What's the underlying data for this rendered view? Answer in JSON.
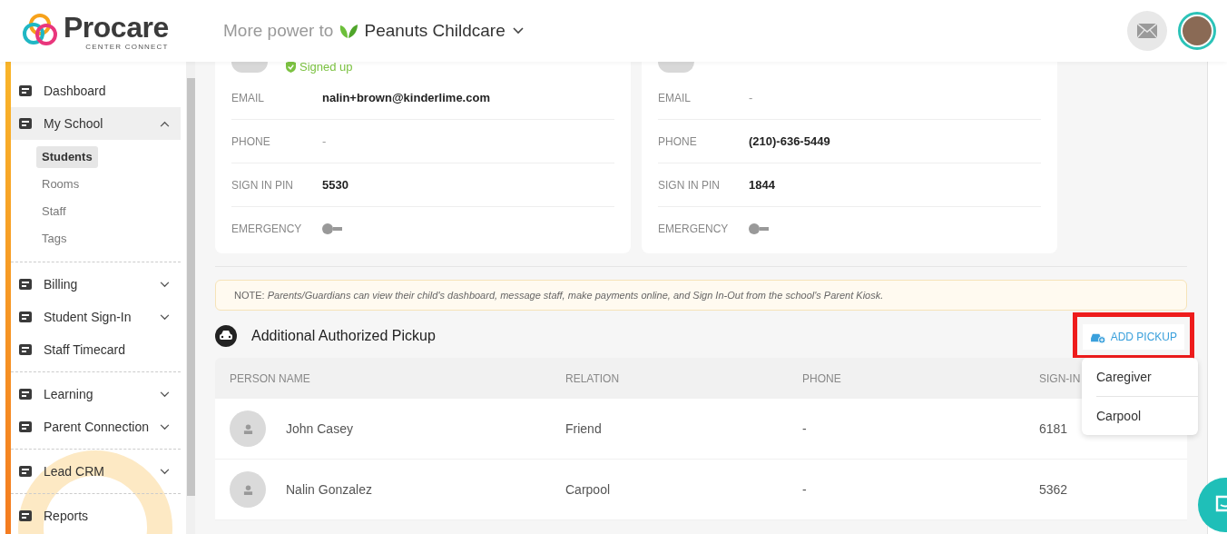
{
  "header": {
    "logo_name": "Procare",
    "logo_tagline": "CENTER CONNECT",
    "slogan": "More power to",
    "school": "Peanuts Childcare"
  },
  "sidebar": {
    "sections": [
      {
        "items": [
          {
            "label": "Dashboard",
            "kind": "link"
          },
          {
            "label": "My School",
            "kind": "group",
            "expanded": true,
            "children": [
              {
                "label": "Students",
                "selected": true
              },
              {
                "label": "Rooms",
                "selected": false
              },
              {
                "label": "Staff",
                "selected": false
              },
              {
                "label": "Tags",
                "selected": false
              }
            ]
          }
        ]
      },
      {
        "items": [
          {
            "label": "Billing",
            "kind": "group",
            "expanded": false
          },
          {
            "label": "Student Sign-In",
            "kind": "group",
            "expanded": false
          },
          {
            "label": "Staff Timecard",
            "kind": "link"
          }
        ]
      },
      {
        "items": [
          {
            "label": "Learning",
            "kind": "group",
            "expanded": false
          },
          {
            "label": "Parent Connection",
            "kind": "group",
            "expanded": false
          }
        ]
      },
      {
        "items": [
          {
            "label": "Lead CRM",
            "kind": "group",
            "expanded": false
          }
        ]
      },
      {
        "items": [
          {
            "label": "Reports",
            "kind": "link"
          }
        ]
      }
    ]
  },
  "guardians": [
    {
      "status": "Signed up",
      "fields": [
        {
          "label": "EMAIL",
          "value": "nalin+brown@kinderlime.com",
          "kind": "text"
        },
        {
          "label": "PHONE",
          "value": "-",
          "kind": "text"
        },
        {
          "label": "SIGN IN PIN",
          "value": "5530",
          "kind": "text"
        },
        {
          "label": "EMERGENCY",
          "kind": "toggle",
          "on": false
        }
      ]
    },
    {
      "fields": [
        {
          "label": "EMAIL",
          "value": "-",
          "kind": "text"
        },
        {
          "label": "PHONE",
          "value": "(210)-636-5449",
          "kind": "text"
        },
        {
          "label": "SIGN IN PIN",
          "value": "1844",
          "kind": "text"
        },
        {
          "label": "EMERGENCY",
          "kind": "toggle",
          "on": false
        }
      ]
    }
  ],
  "note": "NOTE: *Parents/Guardians can view their child's dashboard, message staff, make payments online, and Sign In-Out from the school's Parent Kiosk.*",
  "pickup": {
    "title": "Additional Authorized Pickup",
    "add_button": "ADD PICKUP",
    "menu": [
      "Caregiver",
      "Carpool"
    ],
    "table": {
      "columns": [
        "PERSON NAME",
        "RELATION",
        "PHONE",
        "SIGN-IN"
      ],
      "rows": [
        {
          "name": "John Casey",
          "relation": "Friend",
          "phone": "-",
          "sign_in": "6181"
        },
        {
          "name": "Nalin Gonzalez",
          "relation": "Carpool",
          "phone": "-",
          "sign_in": "5362"
        }
      ]
    }
  }
}
